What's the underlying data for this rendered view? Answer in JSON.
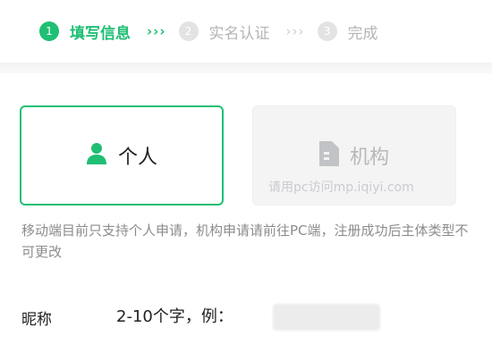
{
  "steps": [
    {
      "number": "1",
      "label": "填写信息",
      "state": "active"
    },
    {
      "number": "2",
      "label": "实名认证",
      "state": "inactive"
    },
    {
      "number": "3",
      "label": "完成",
      "state": "inactive"
    }
  ],
  "step_separator": "›››",
  "account_types": {
    "personal": {
      "label": "个人",
      "icon": "person-icon",
      "selected": true
    },
    "organization": {
      "label": "机构",
      "icon": "document-icon",
      "selected": false
    },
    "watermark": "请用pc访问mp.iqiyi.com"
  },
  "notice": "移动端目前只支持个人申请，机构申请请前往PC端，注册成功后主体类型不可更改",
  "nickname": {
    "label": "昵称",
    "placeholder": "2-10个字，例：",
    "value": ""
  },
  "colors": {
    "accent": "#1fbf74",
    "inactive_step": "#e3e3e3",
    "muted_text": "#8c8c8c",
    "card_disabled_bg": "#f4f4f5"
  }
}
